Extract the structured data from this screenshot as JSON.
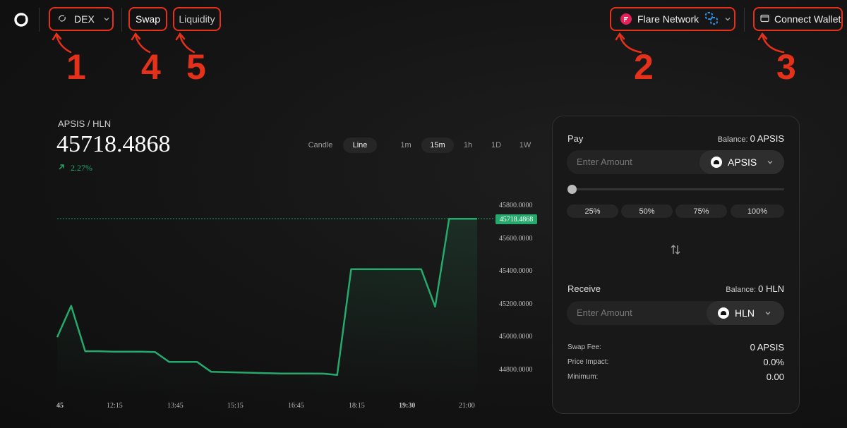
{
  "nav": {
    "dex_label": "DEX",
    "swap_label": "Swap",
    "liquidity_label": "Liquidity",
    "network_label": "Flare Network",
    "wallet_label": "Connect Wallet"
  },
  "callouts": [
    "1",
    "2",
    "3",
    "4",
    "5"
  ],
  "market": {
    "pair": "APSIS / HLN",
    "price": "45718.4868",
    "change": "2.27%",
    "chart_types": [
      "Candle",
      "Line"
    ],
    "active_chart_type": "Line",
    "timeframes": [
      "1m",
      "15m",
      "1h",
      "1D",
      "1W"
    ],
    "active_timeframe": "15m"
  },
  "chart_data": {
    "type": "line",
    "x_tick_labels": [
      "45",
      "12:15",
      "13:45",
      "15:15",
      "16:45",
      "18:15",
      "19:30",
      "21:00"
    ],
    "y_tick_labels": [
      "45800.0000",
      "45600.0000",
      "45400.0000",
      "45200.0000",
      "45000.0000",
      "44800.0000"
    ],
    "current_price_label": "45718.4868",
    "ylim": [
      44700,
      45900
    ],
    "series": [
      {
        "color": "#26a96c",
        "values": [
          45000,
          45190,
          44915,
          44915,
          44912,
          44912,
          44912,
          44910,
          44850,
          44850,
          44850,
          44790,
          44788,
          44786,
          44784,
          44782,
          44780,
          44780,
          44780,
          44779,
          44771,
          45412,
          45412,
          45412,
          45412,
          45412,
          45412,
          45185,
          45718,
          45718,
          45718
        ]
      }
    ],
    "grid": false
  },
  "swap": {
    "pay_label": "Pay",
    "pay_balance_label": "Balance:",
    "pay_balance_value": "0 APSIS",
    "pay_placeholder": "Enter Amount",
    "pay_token": "APSIS",
    "slider_value": 0,
    "percent_buttons": [
      "25%",
      "50%",
      "75%",
      "100%"
    ],
    "receive_label": "Receive",
    "receive_balance_label": "Balance:",
    "receive_balance_value": "0 HLN",
    "receive_placeholder": "Enter Amount",
    "receive_token": "HLN",
    "fees": [
      {
        "label": "Swap Fee:",
        "value": "0 APSIS"
      },
      {
        "label": "Price Impact:",
        "value": "0.0%"
      },
      {
        "label": "Minimum:",
        "value": "0.00"
      }
    ]
  },
  "colors": {
    "accent_green": "#26a96c",
    "callout_red": "#e5311a",
    "network_pink": "#e62058"
  }
}
